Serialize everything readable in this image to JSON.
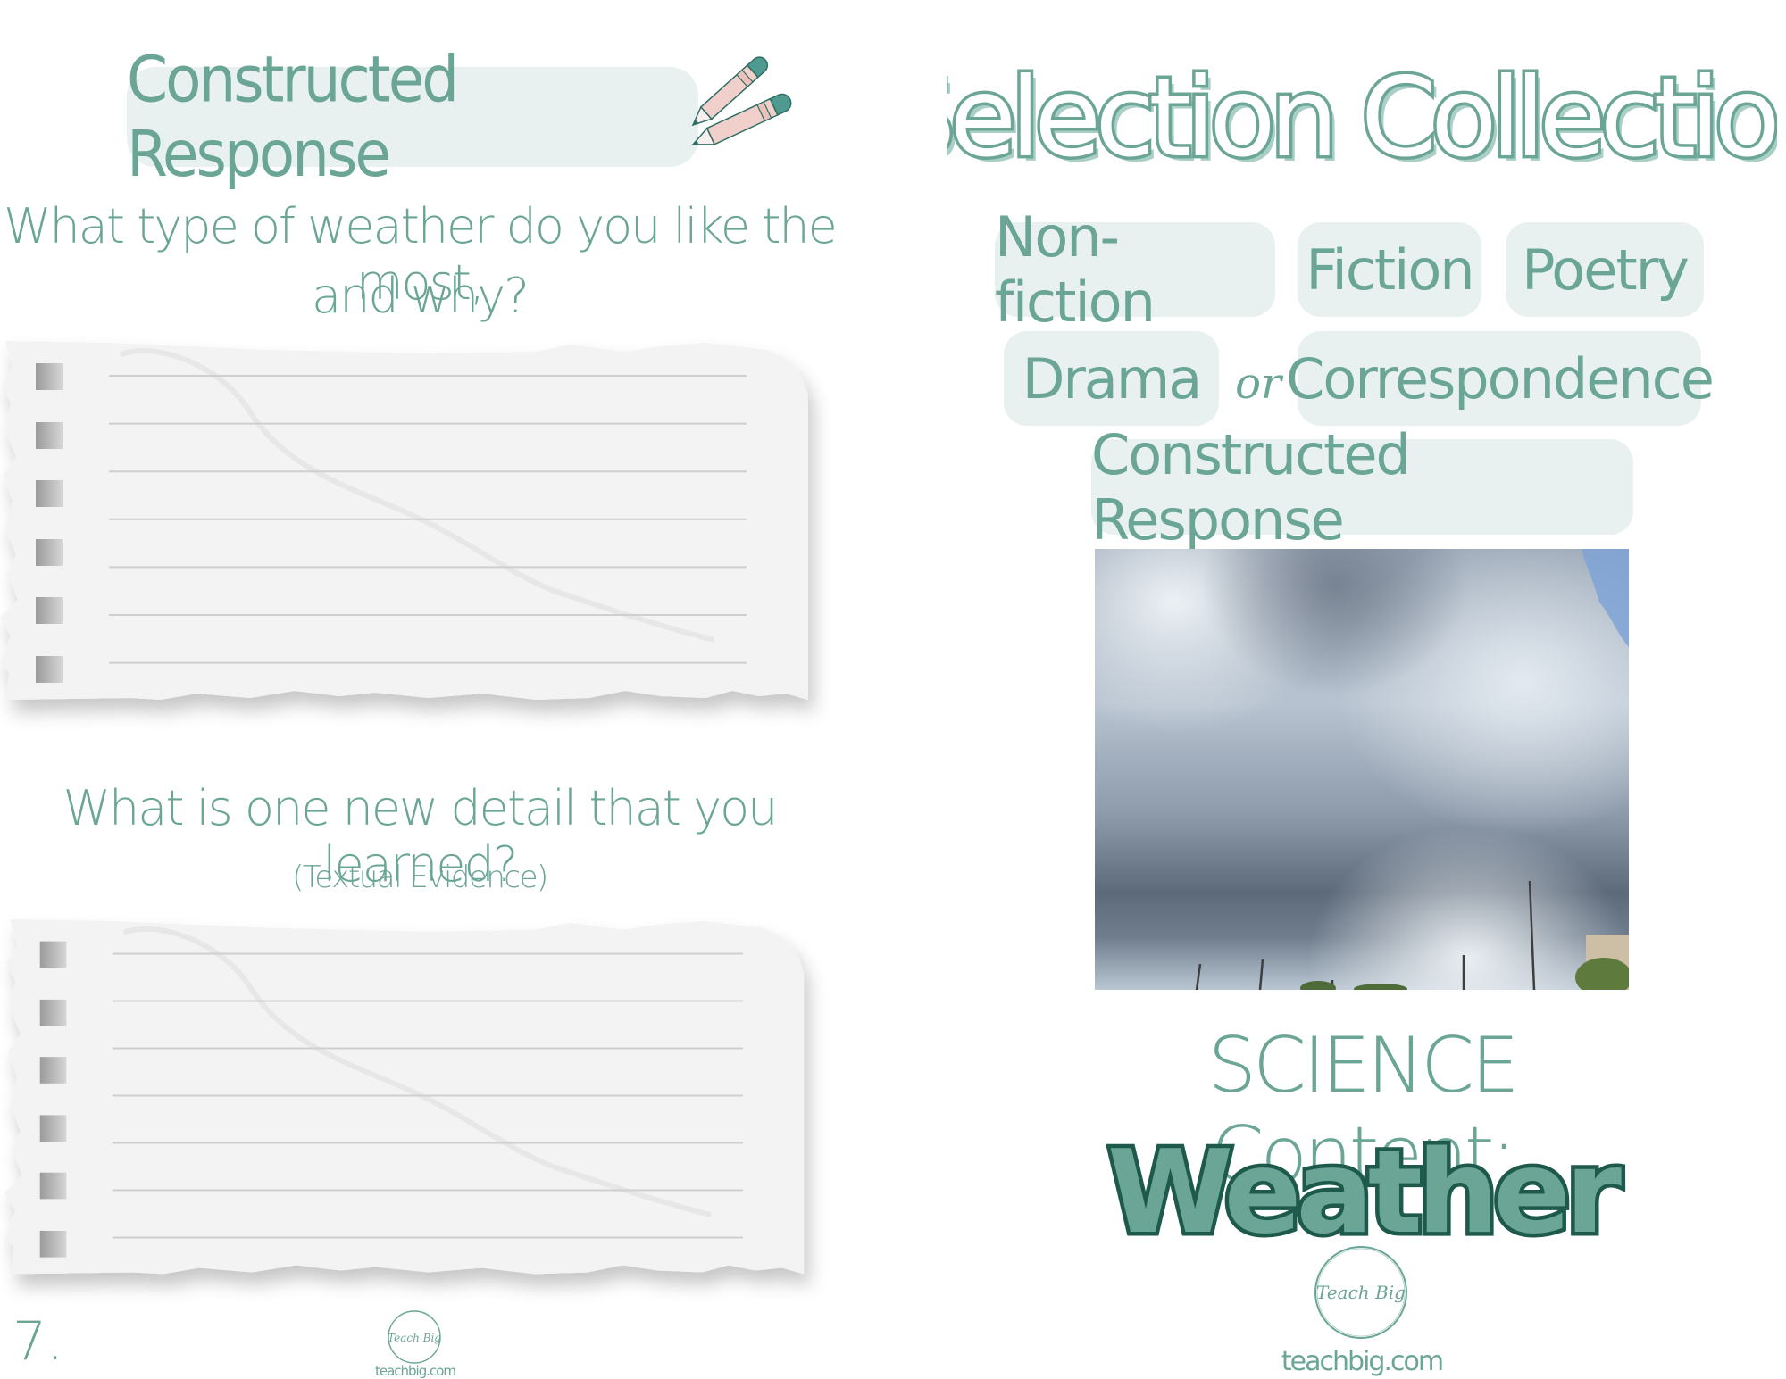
{
  "left_page": {
    "header": {
      "label": "Constructed Response",
      "icon": "pencils-icon"
    },
    "questions": [
      {
        "lines": [
          "What type of weather do you like the most,",
          "and why?"
        ],
        "subtitle": ""
      },
      {
        "lines": [
          "What is one new detail that you learned?"
        ],
        "subtitle": "(Textual Evidence)"
      }
    ],
    "answer_papers": [
      {
        "ruled_lines": 7
      },
      {
        "ruled_lines": 7
      }
    ],
    "page_number": "7.",
    "logo": {
      "text": "Teach Big",
      "url": "teachbig.com"
    }
  },
  "right_page": {
    "title": "Selection Collection",
    "categories": [
      {
        "label": "Non-fiction"
      },
      {
        "label": "Fiction"
      },
      {
        "label": "Poetry"
      },
      {
        "label": "Drama"
      },
      {
        "label": "Correspondence"
      },
      {
        "label": "Constructed Response"
      }
    ],
    "connector": "or",
    "photo": {
      "alt": "Storm clouds over a parking lot with light poles"
    },
    "subject_label": "SCIENCE Content:",
    "topic": "Weather",
    "logo": {
      "text": "Teach Big",
      "url": "teachbig.com"
    }
  },
  "colors": {
    "teal": "#6aa596",
    "pill_background": "#e8f1f0",
    "dark_teal": "#1d5a4c",
    "paper": "#f3f3f3",
    "rule_line": "#cfcfcf"
  }
}
